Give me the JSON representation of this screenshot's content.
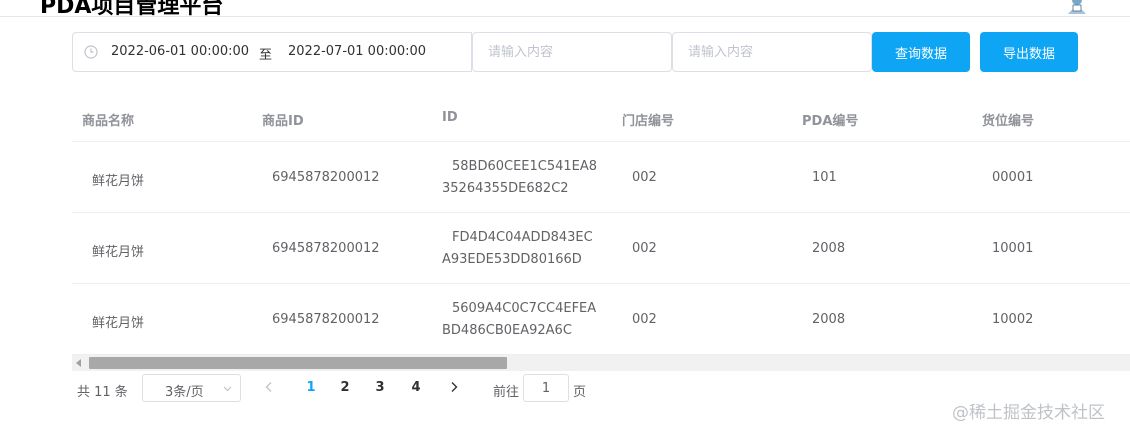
{
  "header": {
    "app_title": "PDA项目管理平台"
  },
  "toolbar": {
    "date_start": "2022-06-01 00:00:00",
    "date_separator": "至",
    "date_end": "2022-07-01 00:00:00",
    "input1_placeholder": "请输入内容",
    "input2_placeholder": "请输入内容",
    "query_label": "查询数据",
    "export_label": "导出数据"
  },
  "table": {
    "columns": [
      "商品名称",
      "商品ID",
      "ID",
      "门店编号",
      "PDA编号",
      "货位编号"
    ],
    "rows": [
      {
        "name": "鲜花月饼",
        "goods_id": "6945878200012",
        "id_line1": "58BD60CEE1C541EA8",
        "id_line2": "35264355DE682C2",
        "store": "002",
        "pda": "101",
        "location": "00001"
      },
      {
        "name": "鲜花月饼",
        "goods_id": "6945878200012",
        "id_line1": "FD4D4C04ADD843EC",
        "id_line2": "A93EDE53DD80166D",
        "store": "002",
        "pda": "2008",
        "location": "10001"
      },
      {
        "name": "鲜花月饼",
        "goods_id": "6945878200012",
        "id_line1": "5609A4C0C7CC4EFEA",
        "id_line2": "BD486CB0EA92A6C",
        "store": "002",
        "pda": "2008",
        "location": "10002"
      }
    ]
  },
  "pagination": {
    "total": "共 11 条",
    "page_size": "3条/页",
    "pages": [
      "1",
      "2",
      "3",
      "4"
    ],
    "current_page": "1",
    "goto_label": "前往",
    "goto_value": "1",
    "page_unit": "页"
  },
  "watermark": "@稀土掘金技术社区",
  "colors": {
    "primary": "#0ea5f5",
    "border": "#dcdfe6",
    "header_text": "#909399",
    "body_text": "#606266"
  }
}
